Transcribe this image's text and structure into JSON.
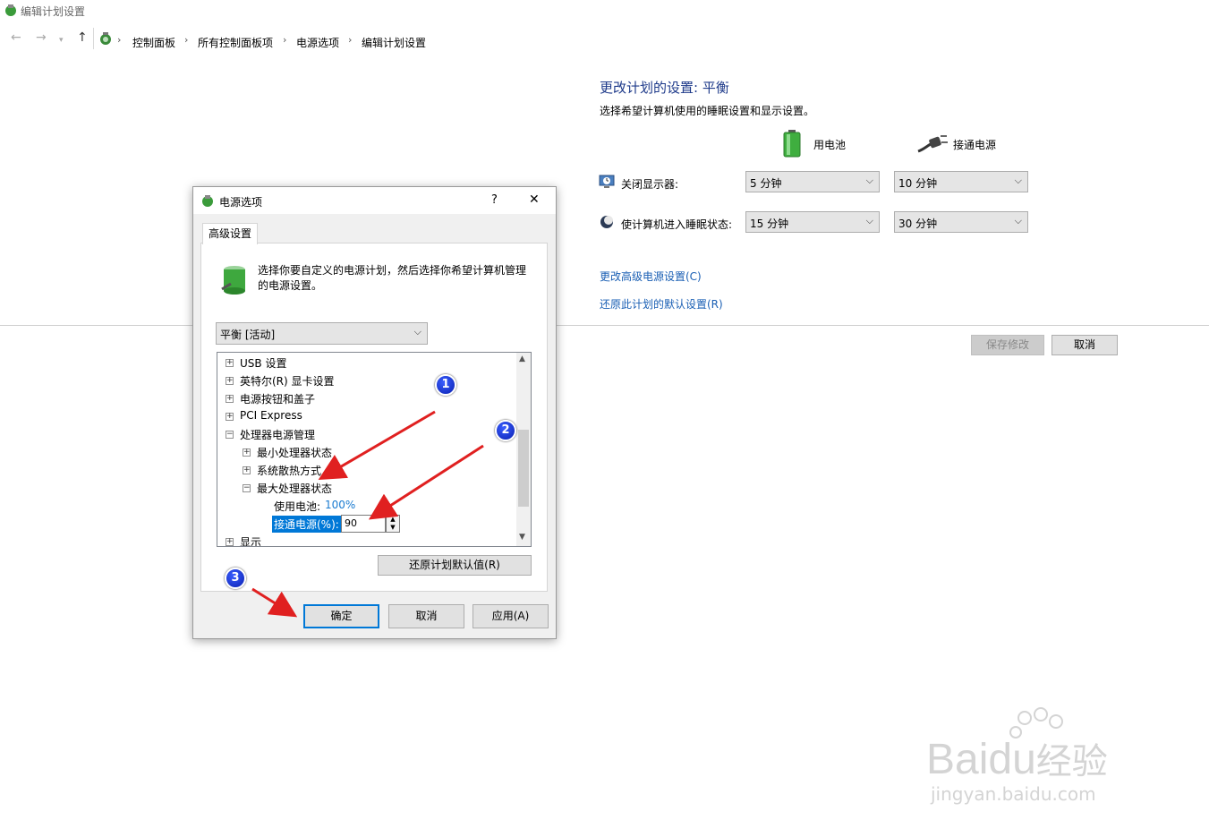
{
  "window": {
    "title": "编辑计划设置"
  },
  "address": {
    "crumbs": [
      "控制面板",
      "所有控制面板项",
      "电源选项",
      "编辑计划设置"
    ]
  },
  "plan": {
    "heading": "更改计划的设置: 平衡",
    "subtitle": "选择希望计算机使用的睡眠设置和显示设置。",
    "col_battery": "用电池",
    "col_ac": "接通电源",
    "rows": [
      {
        "label": "关闭显示器:",
        "battery": "5 分钟",
        "ac": "10 分钟"
      },
      {
        "label": "使计算机进入睡眠状态:",
        "battery": "15 分钟",
        "ac": "30 分钟"
      }
    ],
    "link_advanced": "更改高级电源设置(C)",
    "link_restore": "还原此计划的默认设置(R)",
    "save_label": "保存修改",
    "cancel_label": "取消"
  },
  "dialog": {
    "title": "电源选项",
    "help": "?",
    "close": "✕",
    "tab": "高级设置",
    "intro": [
      "选择你要自定义的电源计划，然后选择你希望计算机管理",
      "的电源设置。"
    ],
    "plan_select": "平衡 [活动]",
    "tree": [
      {
        "label": "USB 设置",
        "expander": "+"
      },
      {
        "label": "英特尔(R) 显卡设置",
        "expander": "+"
      },
      {
        "label": "电源按钮和盖子",
        "expander": "+"
      },
      {
        "label": "PCI Express",
        "expander": "+"
      },
      {
        "label": "处理器电源管理",
        "expander": "−"
      },
      {
        "label": "最小处理器状态",
        "expander": "+"
      },
      {
        "label": "系统散热方式",
        "expander": "+"
      },
      {
        "label": "最大处理器状态",
        "expander": "−"
      },
      {
        "label": "显示",
        "expander": "+"
      }
    ],
    "battery_label": "使用电池:",
    "battery_value": "100%",
    "ac_label": "接通电源(%):",
    "ac_value": "90",
    "restore_btn": "还原计划默认值(R)",
    "ok": "确定",
    "cancel": "取消",
    "apply": "应用(A)"
  },
  "annotations": {
    "b1": "1",
    "b2": "2",
    "b3": "3"
  },
  "watermark": {
    "brand": "Bai",
    "du": "du",
    "cn": "经验",
    "url": "jingyan.baidu.com"
  },
  "colors": {
    "accent": "#0078d7",
    "arrow": "#e02020",
    "link": "#1a5fb4",
    "badge": "#1530d0"
  }
}
